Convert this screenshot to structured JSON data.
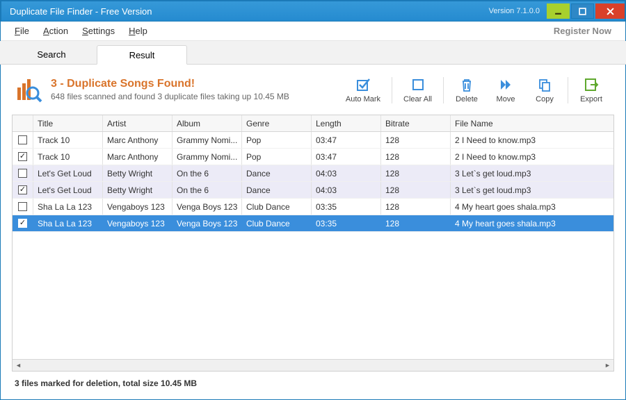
{
  "window": {
    "title": "Duplicate File Finder - Free Version",
    "version": "Version 7.1.0.0"
  },
  "menu": {
    "file": "File",
    "action": "Action",
    "settings": "Settings",
    "help": "Help",
    "register": "Register Now"
  },
  "tabs": {
    "search": "Search",
    "result": "Result"
  },
  "found": {
    "title": "3 - Duplicate Songs Found!",
    "sub": "648 files scanned and found 3 duplicate files taking up 10.45 MB"
  },
  "toolbar": {
    "automark": "Auto Mark",
    "clearall": "Clear All",
    "delete": "Delete",
    "move": "Move",
    "copy": "Copy",
    "export": "Export"
  },
  "columns": {
    "title": "Title",
    "artist": "Artist",
    "album": "Album",
    "genre": "Genre",
    "length": "Length",
    "bitrate": "Bitrate",
    "filename": "File Name"
  },
  "rows": [
    {
      "checked": false,
      "alt": false,
      "sel": false,
      "title": "Track 10",
      "artist": "Marc Anthony",
      "album": "Grammy Nomi...",
      "genre": "Pop",
      "length": "03:47",
      "bitrate": "128",
      "filename": "2 I Need to know.mp3"
    },
    {
      "checked": true,
      "alt": false,
      "sel": false,
      "title": "Track 10",
      "artist": "Marc Anthony",
      "album": "Grammy Nomi...",
      "genre": "Pop",
      "length": "03:47",
      "bitrate": "128",
      "filename": "2 I Need to know.mp3"
    },
    {
      "checked": false,
      "alt": true,
      "sel": false,
      "title": "Let's Get Loud",
      "artist": "Betty Wright",
      "album": "On the 6",
      "genre": "Dance",
      "length": "04:03",
      "bitrate": "128",
      "filename": "3 Let`s get loud.mp3"
    },
    {
      "checked": true,
      "alt": true,
      "sel": false,
      "title": "Let's Get Loud",
      "artist": "Betty Wright",
      "album": "On the 6",
      "genre": "Dance",
      "length": "04:03",
      "bitrate": "128",
      "filename": "3 Let`s get loud.mp3"
    },
    {
      "checked": false,
      "alt": false,
      "sel": false,
      "title": "Sha La La 123",
      "artist": "Vengaboys 123",
      "album": "Venga Boys 123",
      "genre": "Club Dance",
      "length": "03:35",
      "bitrate": "128",
      "filename": "4 My heart goes shala.mp3"
    },
    {
      "checked": true,
      "alt": false,
      "sel": true,
      "title": "Sha La La 123",
      "artist": "Vengaboys 123",
      "album": "Venga Boys 123",
      "genre": "Club Dance",
      "length": "03:35",
      "bitrate": "128",
      "filename": "4 My heart goes shala.mp3"
    }
  ],
  "status": "3 files marked for deletion, total size 10.45 MB"
}
